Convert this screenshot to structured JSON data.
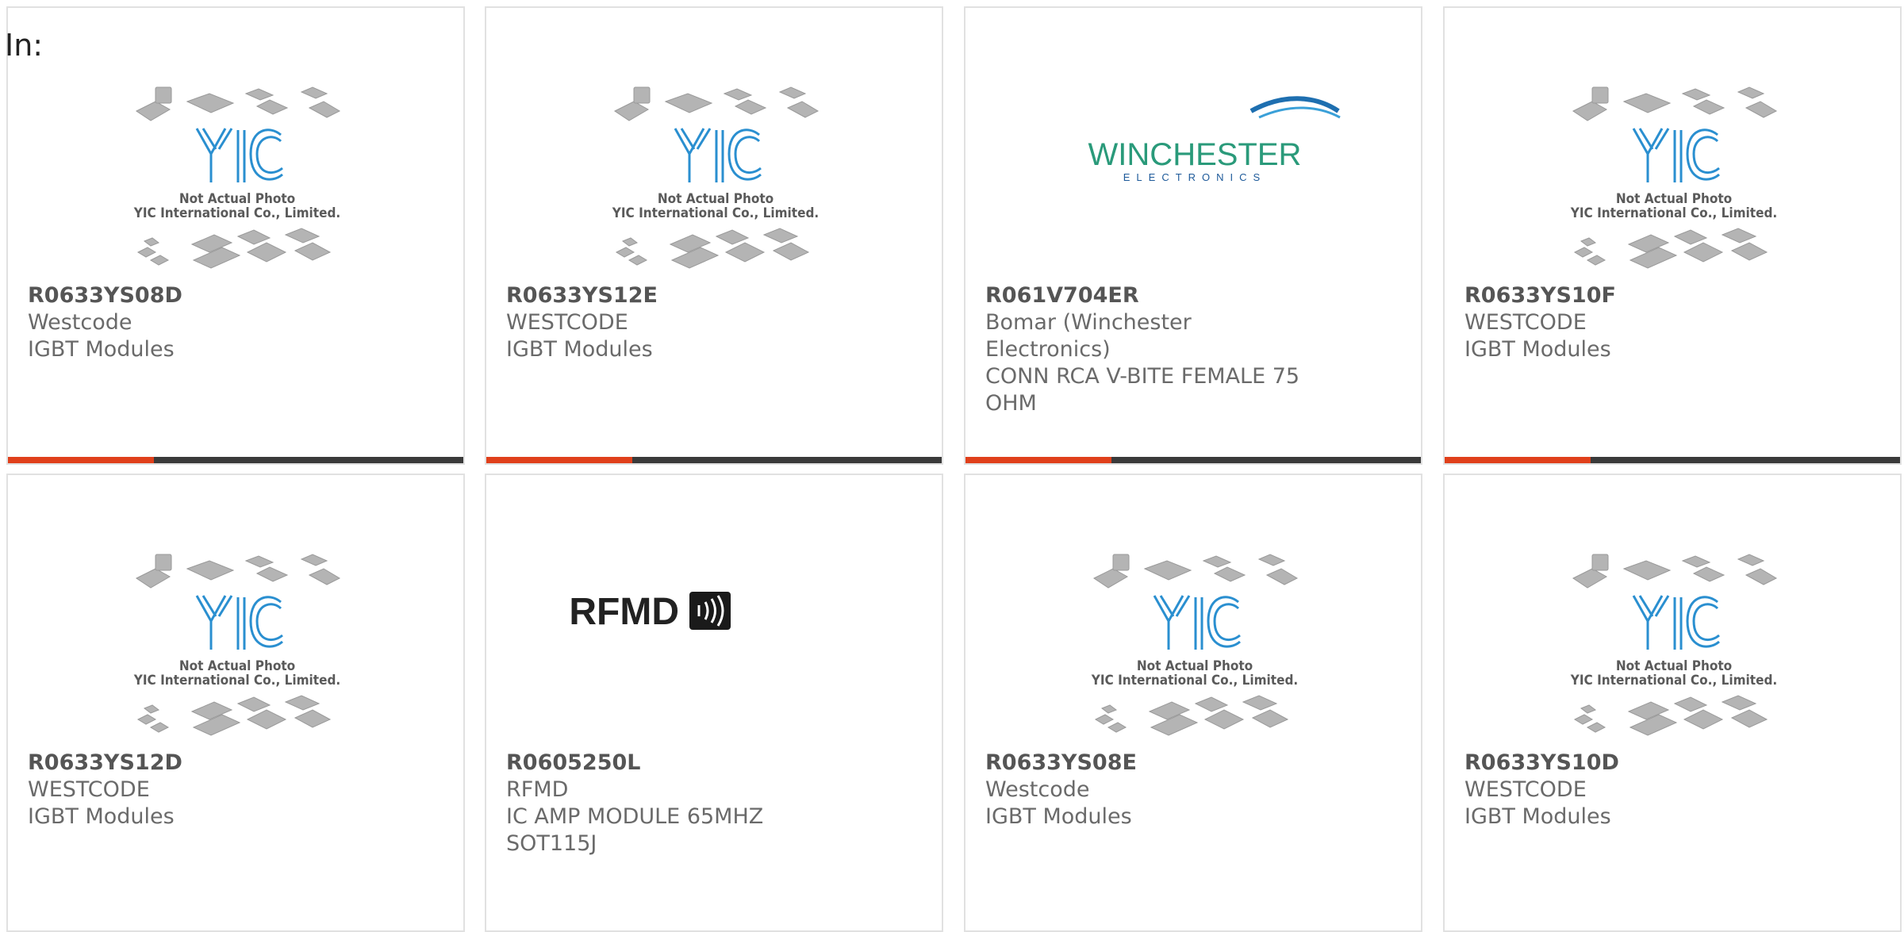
{
  "header": {
    "label": "In:"
  },
  "accent": "#e0401b",
  "bar_track": "#3a3a3a",
  "placeholder": {
    "icon": "yic-placeholder-image",
    "caption_line1": "Not Actual Photo",
    "caption_line2": "YIC International Co., Limited.",
    "logo_text": "YIC"
  },
  "cards": [
    {
      "part": "R0633YS08D",
      "maker": "Westcode",
      "desc": "IGBT Modules",
      "image": "yic-placeholder",
      "progress": 0.32
    },
    {
      "part": "R0633YS12E",
      "maker": "WESTCODE",
      "desc": "IGBT Modules",
      "image": "yic-placeholder",
      "progress": 0.32
    },
    {
      "part": "R061V704ER",
      "maker": "Bomar (Winchester Electronics)",
      "desc": "CONN RCA V-BITE FEMALE 75 OHM",
      "image": "winchester-logo",
      "progress": 0.32
    },
    {
      "part": "R0633YS10F",
      "maker": "WESTCODE",
      "desc": "IGBT Modules",
      "image": "yic-placeholder",
      "progress": 0.32
    },
    {
      "part": "R0633YS12D",
      "maker": "WESTCODE",
      "desc": "IGBT Modules",
      "image": "yic-placeholder",
      "progress": null
    },
    {
      "part": "R0605250L",
      "maker": "RFMD",
      "desc": "IC AMP MODULE 65MHZ SOT115J",
      "image": "rfmd-logo",
      "progress": null
    },
    {
      "part": "R0633YS08E",
      "maker": "Westcode",
      "desc": "IGBT Modules",
      "image": "yic-placeholder",
      "progress": null
    },
    {
      "part": "R0633YS10D",
      "maker": "WESTCODE",
      "desc": "IGBT Modules",
      "image": "yic-placeholder",
      "progress": null
    }
  ],
  "logos": {
    "winchester": {
      "line1": "WINCHESTER",
      "line2": "ELECTRONICS",
      "color": "#2a9a7a",
      "sub_color": "#1e5a9a"
    },
    "rfmd": {
      "text": "RFMD"
    }
  }
}
